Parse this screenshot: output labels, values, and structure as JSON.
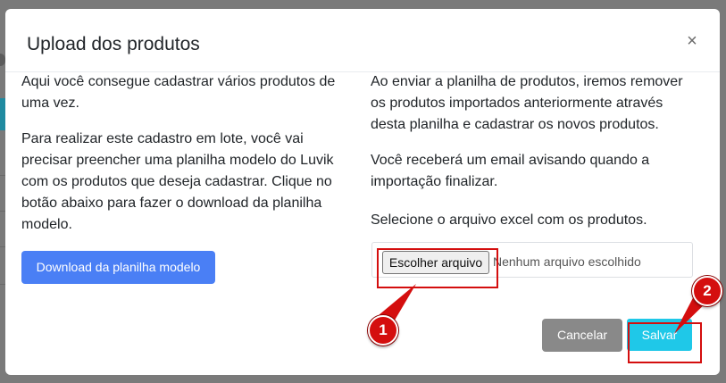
{
  "modal": {
    "title": "Upload dos produtos",
    "close_symbol": "×"
  },
  "left": {
    "paragraph_1": "Aqui você consegue cadastrar vários produtos de uma vez.",
    "paragraph_2": "Para realizar este cadastro em lote, você vai precisar preencher uma planilha modelo do Luvik com os produtos que deseja cadastrar. Clique no botão abaixo para fazer o download da planilha modelo.",
    "download_button": "Download da planilha modelo"
  },
  "right": {
    "paragraph_1": "Ao enviar a planilha de produtos, iremos remover os produtos importados anteriormente através desta planilha e cadastrar os novos produtos.",
    "paragraph_2": "Você receberá um email avisando quando a importação finalizar.",
    "paragraph_3": "Selecione o arquivo excel com os produtos.",
    "file_button": "Escolher arquivo",
    "file_status": "Nenhum arquivo escolhido"
  },
  "footer": {
    "cancel_label": "Cancelar",
    "save_label": "Salvar"
  },
  "annotations": {
    "marker_1": "1",
    "marker_2": "2",
    "color": "#d40e0e"
  },
  "colors": {
    "primary": "#4a7ff5",
    "info": "#1fc8e8",
    "secondary": "#898989"
  }
}
